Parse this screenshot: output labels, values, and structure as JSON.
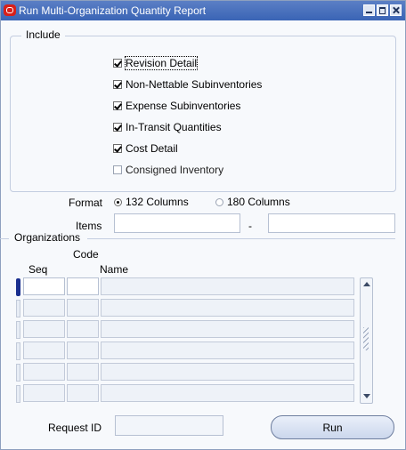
{
  "window": {
    "title": "Run Multi-Organization Quantity Report"
  },
  "include": {
    "label": "Include",
    "options": [
      {
        "label": "Revision Detail",
        "checked": true
      },
      {
        "label": "Non-Nettable Subinventories",
        "checked": true
      },
      {
        "label": "Expense Subinventories",
        "checked": true
      },
      {
        "label": "In-Transit Quantities",
        "checked": true
      },
      {
        "label": "Cost Detail",
        "checked": true
      },
      {
        "label": "Consigned Inventory",
        "checked": false
      }
    ]
  },
  "format": {
    "label": "Format",
    "options": [
      {
        "label": "132 Columns",
        "selected": true
      },
      {
        "label": "180 Columns",
        "selected": false
      }
    ]
  },
  "items": {
    "label": "Items",
    "from_value": "",
    "separator": "-",
    "to_value": ""
  },
  "organizations": {
    "label": "Organizations",
    "columns": {
      "seq": "Seq",
      "code": "Code",
      "name": "Name"
    },
    "rows": [
      {
        "seq": "",
        "code": "",
        "name": ""
      },
      {
        "seq": "",
        "code": "",
        "name": ""
      },
      {
        "seq": "",
        "code": "",
        "name": ""
      },
      {
        "seq": "",
        "code": "",
        "name": ""
      },
      {
        "seq": "",
        "code": "",
        "name": ""
      },
      {
        "seq": "",
        "code": "",
        "name": ""
      }
    ]
  },
  "request_id": {
    "label": "Request ID",
    "value": ""
  },
  "run_button": {
    "label": "Run"
  },
  "icons": {
    "app": "oracle-logo-icon",
    "minimize": "minimize-icon",
    "maximize": "maximize-icon",
    "close": "close-icon"
  }
}
